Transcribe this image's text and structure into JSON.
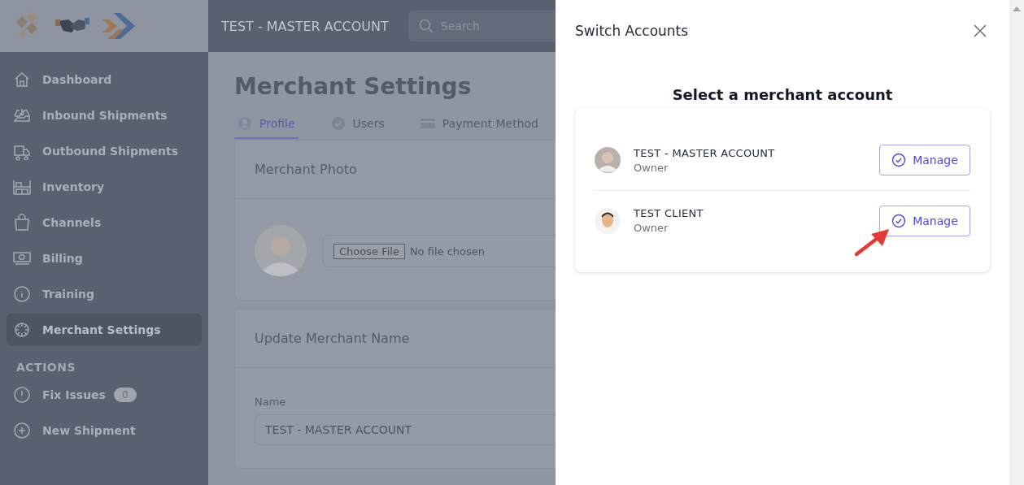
{
  "sidebar": {
    "items": [
      {
        "label": "Dashboard",
        "selected": false
      },
      {
        "label": "Inbound Shipments",
        "selected": false
      },
      {
        "label": "Outbound Shipments",
        "selected": false
      },
      {
        "label": "Inventory",
        "selected": false
      },
      {
        "label": "Channels",
        "selected": false
      },
      {
        "label": "Billing",
        "selected": false
      },
      {
        "label": "Training",
        "selected": false
      },
      {
        "label": "Merchant Settings",
        "selected": true
      }
    ],
    "section_title": "ACTIONS",
    "actions": [
      {
        "label": "Fix Issues",
        "badge": "0"
      },
      {
        "label": "New Shipment"
      }
    ]
  },
  "header": {
    "account": "TEST - MASTER ACCOUNT",
    "search": {
      "placeholder": "Search"
    }
  },
  "page": {
    "title": "Merchant Settings",
    "tabs": [
      {
        "label": "Profile",
        "selected": true
      },
      {
        "label": "Users",
        "selected": false
      },
      {
        "label": "Payment Method",
        "selected": false
      }
    ],
    "photo_card": {
      "title": "Merchant Photo",
      "file_button": "Choose File",
      "file_status": "No file chosen"
    },
    "name_card": {
      "title": "Update Merchant Name",
      "field_label": "Name",
      "value": "TEST - MASTER ACCOUNT"
    }
  },
  "drawer": {
    "title": "Switch Accounts",
    "heading": "Select a merchant account",
    "accounts": [
      {
        "name": "TEST - MASTER ACCOUNT",
        "role": "Owner",
        "button": "Manage",
        "pointed": false
      },
      {
        "name": "TEST CLIENT",
        "role": "Owner",
        "button": "Manage",
        "pointed": true
      }
    ]
  }
}
